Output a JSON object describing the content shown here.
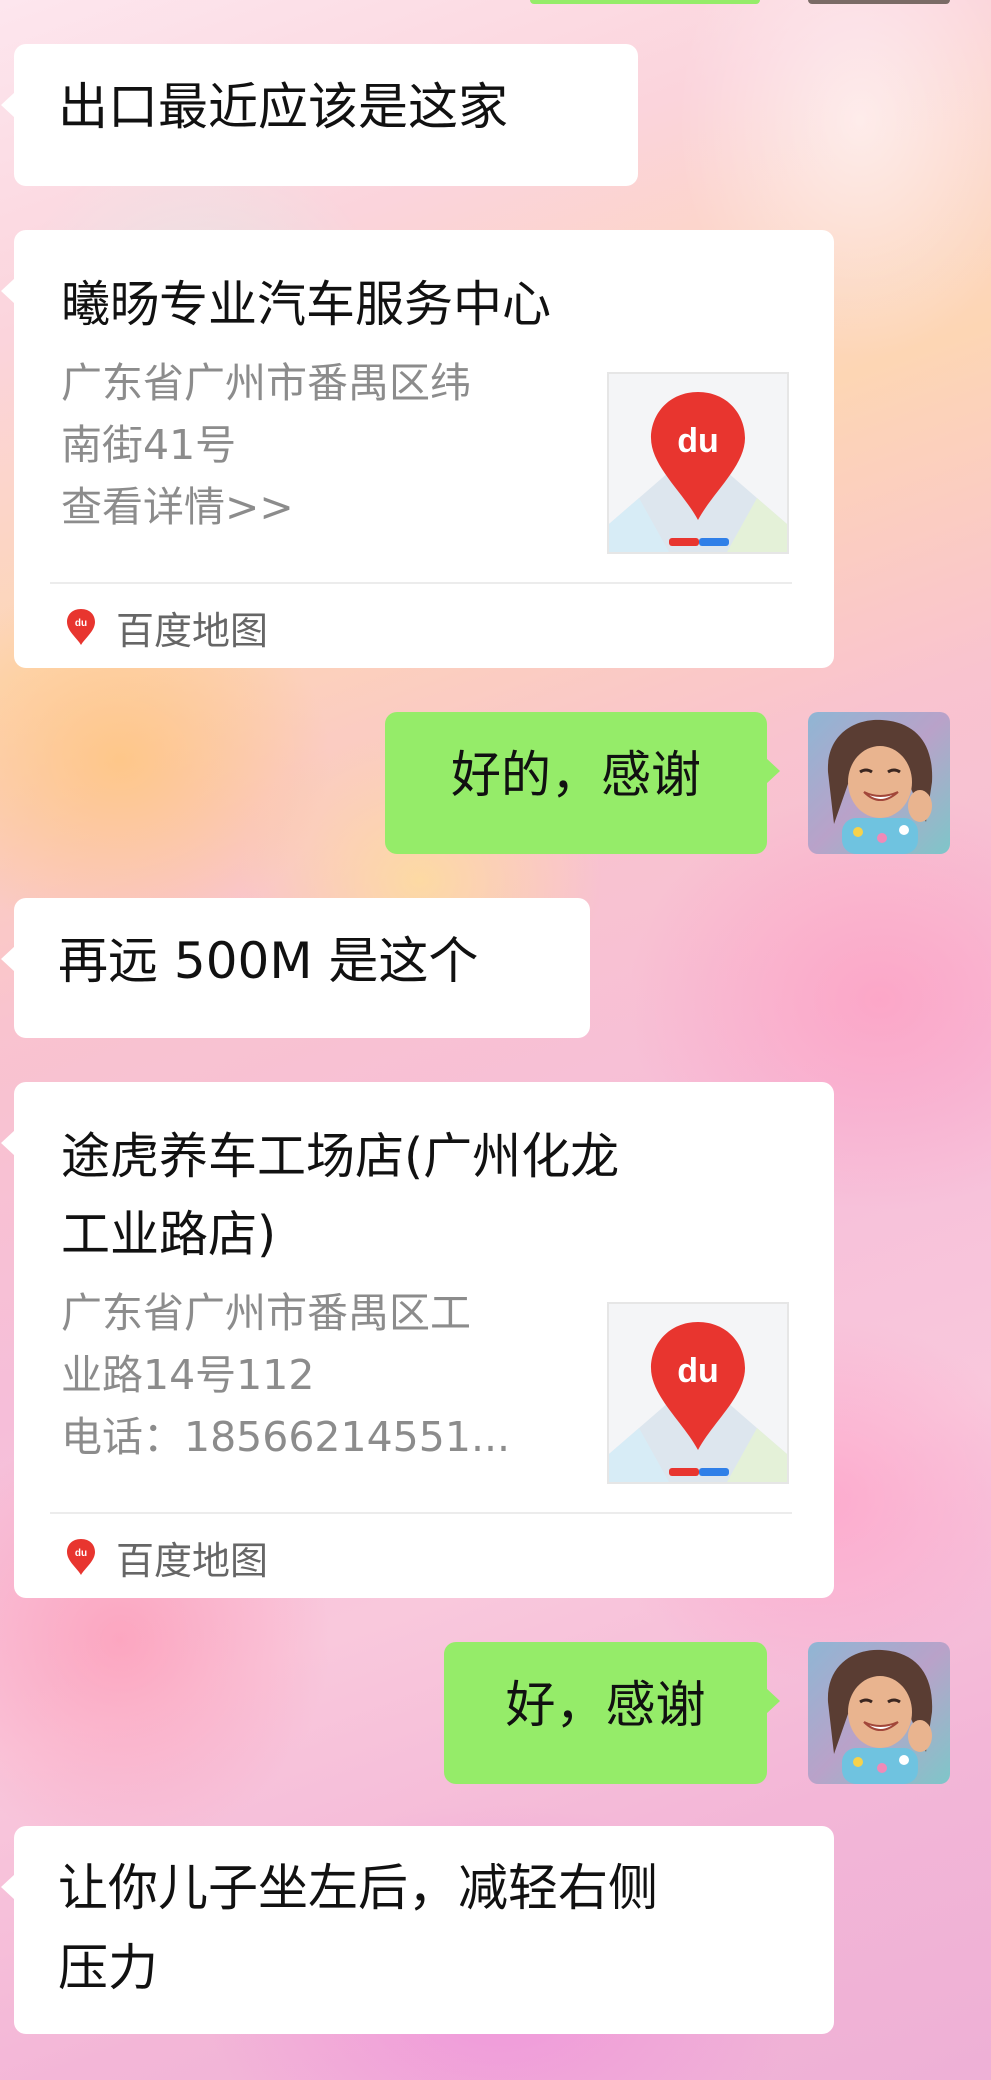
{
  "colors": {
    "incoming_bubble": "#ffffff",
    "outgoing_bubble": "#95ec69",
    "baidu_red": "#e8352f",
    "secondary_text": "#8c8c8c"
  },
  "messages": {
    "m1_text": "出口最近应该是这家",
    "card1": {
      "title": "曦旸专业汽车服务中心",
      "address_line1": "广东省广州市番禺区纬",
      "address_line2": "南街41号",
      "detail_line": "查看详情>>",
      "map_logo_text": "du",
      "source_label": "百度地图",
      "source_icon": "baidu-map-icon"
    },
    "m2_text": "好的，感谢",
    "m3_text": "再远 500M 是这个",
    "card2": {
      "title_line1": "途虎养车工场店(广州化龙",
      "title_line2": "工业路店)",
      "address_line1": "广东省广州市番禺区工",
      "address_line2": "业路14号112",
      "detail_line": "电话：18566214551...",
      "map_logo_text": "du",
      "source_label": "百度地图",
      "source_icon": "baidu-map-icon"
    },
    "m4_text": "好，感谢",
    "m5_line1": "让你儿子坐左后，减轻右侧",
    "m5_line2": "压力"
  }
}
